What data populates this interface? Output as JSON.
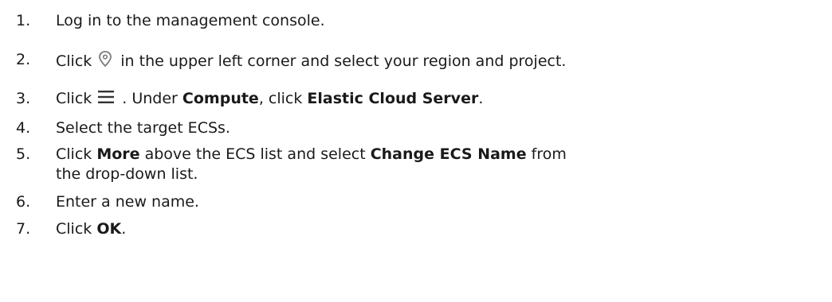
{
  "steps": [
    {
      "number": "1.",
      "text": "Log in to the management console."
    },
    {
      "number": "2.",
      "pre": "Click",
      "icon": "location-pin-icon",
      "post": "in the upper left corner and select your region and project."
    },
    {
      "number": "3.",
      "pre": "Click",
      "icon": "hamburger-menu-icon",
      "mid": ". Under ",
      "bold1": "Compute",
      "mid2": ", click ",
      "bold2": "Elastic Cloud Server",
      "end": "."
    },
    {
      "number": "4.",
      "text": "Select the target ECSs."
    },
    {
      "number": "5.",
      "pre": "Click ",
      "bold1": "More",
      "mid": " above the ECS list and select ",
      "bold2": "Change ECS Name",
      "end": " from the drop-down list."
    },
    {
      "number": "6.",
      "text": "Enter a new name."
    },
    {
      "number": "7.",
      "pre": "Click ",
      "bold1": "OK",
      "end": "."
    }
  ]
}
